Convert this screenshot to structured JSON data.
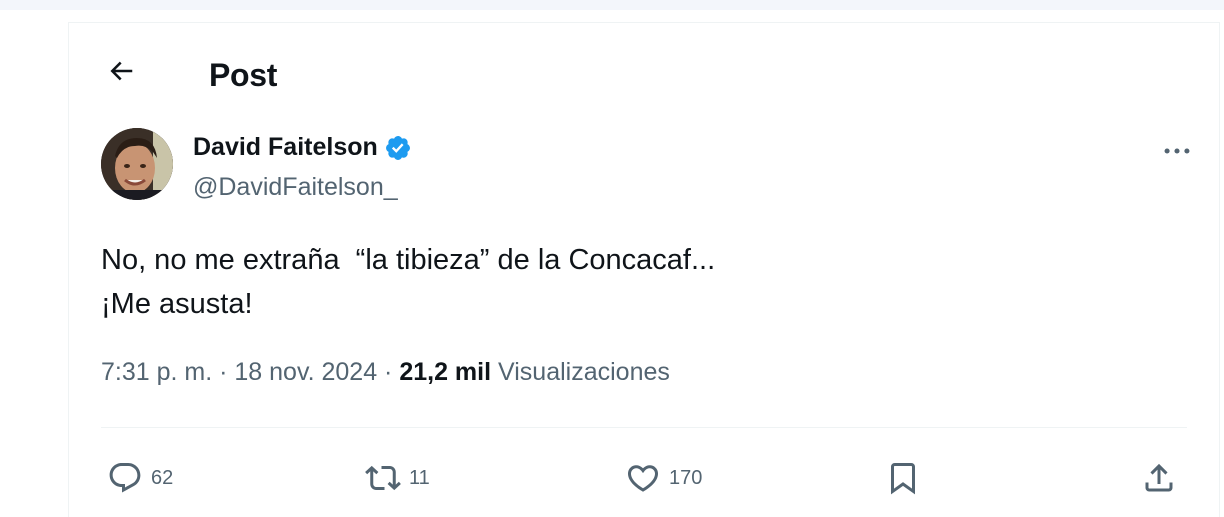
{
  "header": {
    "title": "Post",
    "back_icon": "arrow-left-icon"
  },
  "author": {
    "display_name": "David Faitelson",
    "handle": "@DavidFaitelson_",
    "verified": true,
    "verified_color": "#1d9bf0"
  },
  "post": {
    "lines": [
      "No, no me extraña  “la tibieza” de la Concacaf...",
      "¡Me asusta!"
    ],
    "time": "7:31 p. m.",
    "separator": " · ",
    "date": "18 nov. 2024",
    "views_count": "21,2 mil",
    "views_label": "Visualizaciones"
  },
  "actions": {
    "reply_count": "62",
    "repost_count": "11",
    "like_count": "170",
    "icons": [
      "reply-icon",
      "repost-icon",
      "like-icon",
      "bookmark-icon",
      "share-icon"
    ]
  },
  "colors": {
    "text_primary": "#0f1419",
    "text_secondary": "#536471",
    "accent": "#1d9bf0"
  }
}
